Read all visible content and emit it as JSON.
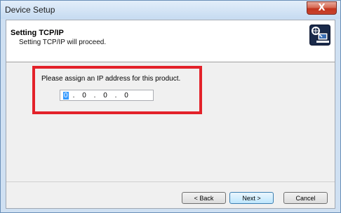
{
  "window": {
    "title": "Device Setup",
    "close_symbol": "X"
  },
  "header": {
    "title": "Setting TCP/IP",
    "subtitle": "Setting TCP/IP will proceed.",
    "icon": "network-computer-icon"
  },
  "ip_section": {
    "prompt": "Please assign an IP address for this product.",
    "octets": [
      "0",
      "0",
      "0",
      "0"
    ],
    "separator": "."
  },
  "buttons": {
    "back_label": "< Back",
    "next_label": "Next >",
    "cancel_label": "Cancel"
  },
  "colors": {
    "highlight": "#e3222a",
    "close_button": "#c8432c",
    "selection": "#3399ff"
  }
}
